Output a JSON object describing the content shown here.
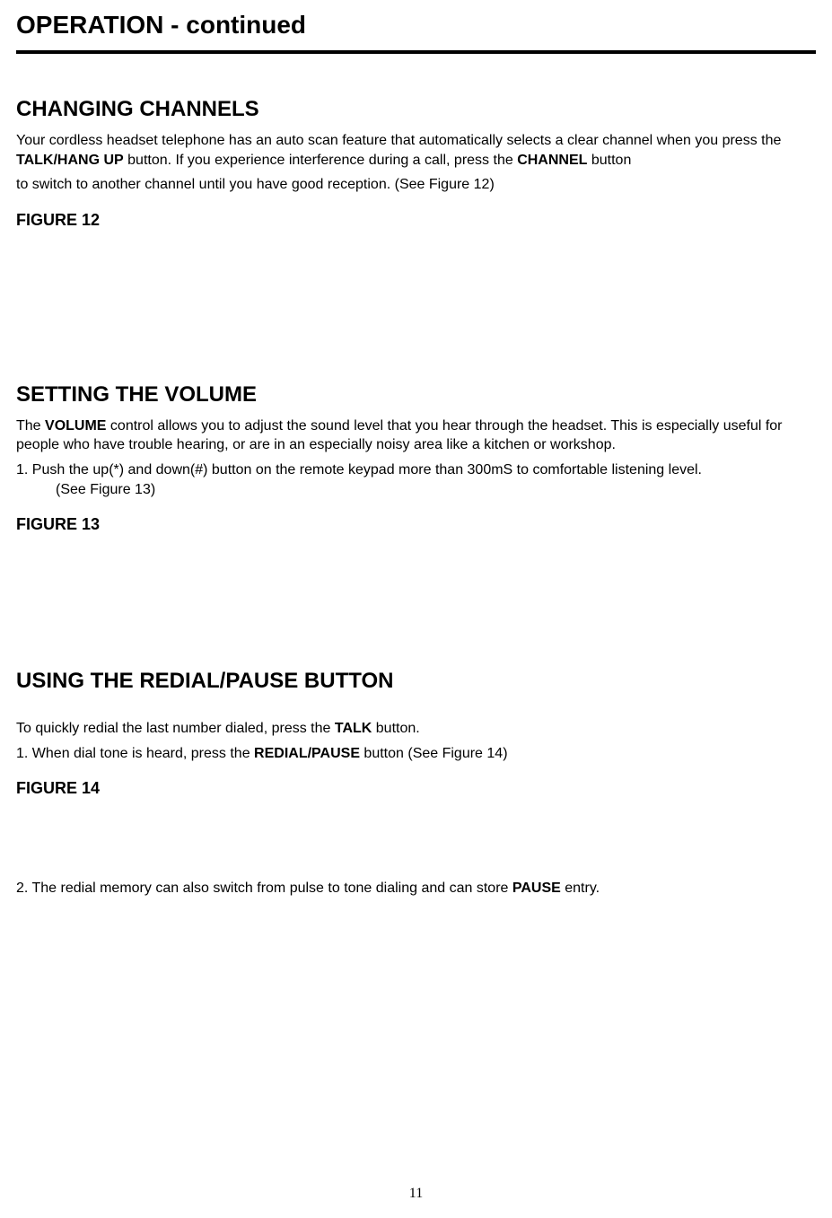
{
  "header": {
    "title_main": "OPERATION",
    "title_suffix": " - continued"
  },
  "sections": {
    "changing_channels": {
      "heading": "CHANGING CHANNELS",
      "p1_a": "Your cordless headset telephone has an auto scan feature that automatically selects a clear channel when you press the ",
      "p1_bold1": "TALK/HANG UP",
      "p1_b": " button. If you experience interference during a call, press the ",
      "p1_bold2": "CHANNEL",
      "p1_c": " button",
      "p2": "to switch to another channel until you have good reception. (See Figure 12)",
      "figure_label": "FIGURE 12"
    },
    "setting_volume": {
      "heading": "SETTING THE VOLUME",
      "p1_a": "The ",
      "p1_bold1": "VOLUME",
      "p1_b": " control allows you to adjust the sound level that you hear through the headset. This is especially useful for people who have trouble hearing, or are in an especially noisy area like a kitchen or workshop.",
      "list1_main": "1. Push the up(*) and down(#) button on the remote keypad more than 300mS to comfortable listening level.",
      "list1_sub": "(See Figure 13)",
      "figure_label": "FIGURE 13"
    },
    "redial_pause": {
      "heading": "USING THE REDIAL/PAUSE BUTTON",
      "p1_a": "To quickly redial the last number dialed, press the ",
      "p1_bold1": "TALK",
      "p1_b": " button.",
      "list1_a": "1. When dial tone is heard, press the ",
      "list1_bold": "REDIAL/PAUSE",
      "list1_b": " button (See Figure 14)",
      "figure_label": "FIGURE 14",
      "list2_a": "2. The redial memory can also switch from pulse to tone dialing and can store ",
      "list2_bold": "PAUSE",
      "list2_b": " entry."
    }
  },
  "page_number": "11"
}
